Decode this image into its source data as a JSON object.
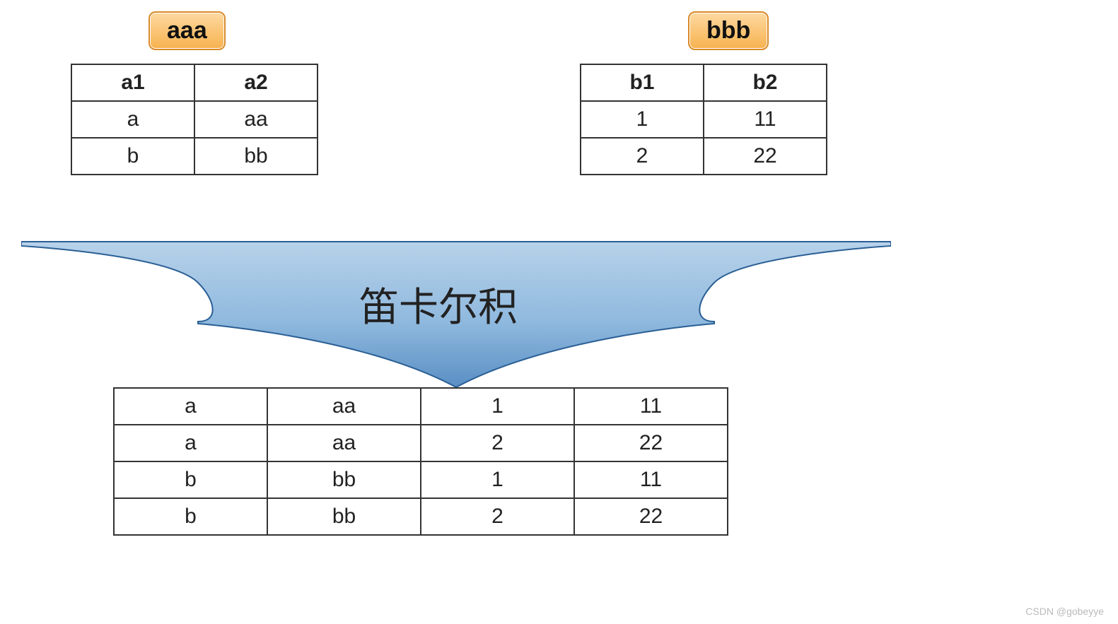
{
  "tableA": {
    "title": "aaa",
    "headers": [
      "a1",
      "a2"
    ],
    "rows": [
      [
        "a",
        "aa"
      ],
      [
        "b",
        "bb"
      ]
    ]
  },
  "tableB": {
    "title": "bbb",
    "headers": [
      "b1",
      "b2"
    ],
    "rows": [
      [
        "1",
        "11"
      ],
      [
        "2",
        "22"
      ]
    ]
  },
  "arrowLabel": "笛卡尔积",
  "resultTable": {
    "rows": [
      [
        "a",
        "aa",
        "1",
        "11"
      ],
      [
        "a",
        "aa",
        "2",
        "22"
      ],
      [
        "b",
        "bb",
        "1",
        "11"
      ],
      [
        "b",
        "bb",
        "2",
        "22"
      ]
    ]
  },
  "watermark": "CSDN @gobeyye"
}
